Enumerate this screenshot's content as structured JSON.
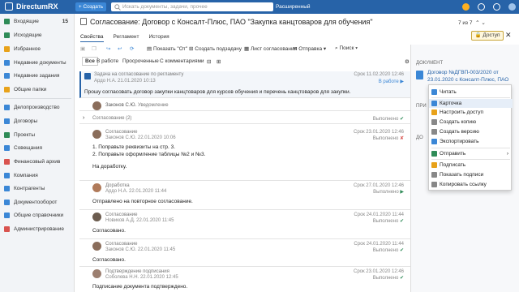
{
  "app": {
    "logo": "DirectumRX",
    "create_label": "+ Создать",
    "search_placeholder": "Искать документы, задачи, прочее",
    "advanced_search": "Расширенный поиск"
  },
  "sidebar": {
    "items": [
      {
        "label": "Входящие",
        "count": "15",
        "color": "#2e8b57"
      },
      {
        "label": "Исходящие",
        "count": "",
        "color": "#2e8b57"
      },
      {
        "label": "Избранное",
        "count": "",
        "color": "#e8a21a"
      },
      {
        "label": "Недавние документы",
        "count": "",
        "color": "#3b87d6"
      },
      {
        "label": "Недавние задания",
        "count": "",
        "color": "#3b87d6"
      },
      {
        "label": "Общие папки",
        "count": "",
        "color": "#e8a21a"
      },
      {
        "label": "Делопроизводство",
        "count": "",
        "color": "#3b87d6"
      },
      {
        "label": "Договоры",
        "count": "",
        "color": "#3b87d6"
      },
      {
        "label": "Проекты",
        "count": "",
        "color": "#2e8b57"
      },
      {
        "label": "Совещания",
        "count": "",
        "color": "#3b87d6"
      },
      {
        "label": "Финансовый архив",
        "count": "",
        "color": "#d9534f"
      },
      {
        "label": "Компания",
        "count": "",
        "color": "#3b87d6"
      },
      {
        "label": "Контрагенты",
        "count": "",
        "color": "#3b87d6"
      },
      {
        "label": "Документооборот",
        "count": "",
        "color": "#3b87d6"
      },
      {
        "label": "Общие справочники",
        "count": "",
        "color": "#3b87d6"
      },
      {
        "label": "Администрирование",
        "count": "",
        "color": "#d9534f"
      }
    ]
  },
  "header": {
    "title": "Согласование: Договор с Консалт-Плюс, ПАО \"Закупка канцтоваров для обучения\"",
    "pager": "7 из 7",
    "access": "Доступ"
  },
  "tabs": [
    "Свойства",
    "Регламент",
    "История"
  ],
  "toolbar": [
    "Показать \"От\"",
    "Создать подзадачу",
    "Лист согласования",
    "Отправка",
    "Поиск"
  ],
  "filters": [
    "Все",
    "В работе",
    "Просроченные",
    "С комментариями"
  ],
  "task": {
    "type": "Задача на согласование по регламенту",
    "author": "Ардо Н.А.   21.01.2020 10:13",
    "due": "Срок 11.02.2020 12:46",
    "status": "В работе",
    "text": "Прошу согласовать договор закупки канцтоваров для курсов обучения и перечень канцтоваров для закупки."
  },
  "notice": {
    "author": "Законов С.Ю.",
    "type": "Уведомление"
  },
  "group": {
    "label": "Согласование (2)",
    "status": "Выполнено"
  },
  "items": [
    {
      "type": "Согласование",
      "author": "Законов С.Ю.  22.01.2020 10:06",
      "due": "Срок 23.01.2020 12:46",
      "status": "Выполнено",
      "lines": [
        "1. Поправьте реквизиты на стр. 3.",
        "2. Поправьте оформление таблицы №2 и №3.",
        "",
        "На доработку."
      ],
      "avcolor": "#8a6d5b"
    },
    {
      "type": "Доработка",
      "author": "Ардо Н.А.  22.01.2020 11:44",
      "due": "Срок 27.01.2020 12:46",
      "status": "Выполнено",
      "lines": [
        "Отправлено на повторное согласование."
      ],
      "avcolor": "#b07a5a"
    },
    {
      "type": "Согласование",
      "author": "Новиков А.Д.  22.01.2020 11:45",
      "due": "Срок 24.01.2020 11:44",
      "status": "Выполнено",
      "lines": [
        "Согласовано."
      ],
      "avcolor": "#6b5c4f"
    },
    {
      "type": "Согласование",
      "author": "Законов С.Ю.  22.01.2020 11:45",
      "due": "Срок 24.01.2020 11:44",
      "status": "Выполнено",
      "lines": [
        "Согласовано."
      ],
      "avcolor": "#8a6d5b"
    },
    {
      "type": "Подтверждение подписания",
      "author": "Соболева Н.Н.  22.01.2020 12:45",
      "due": "Срок 23.01.2020 12:46",
      "status": "Выполнено",
      "lines": [
        "Подписание документа подтверждено."
      ],
      "avcolor": "#9c7f70"
    }
  ],
  "right": {
    "doc_header": "ДОКУМЕНТ",
    "doc_link": "Договор №ДГВП-003/2020 от 23.01.2020 с Консалт-Плюс, ПАО",
    "h2": "ПРИ",
    "h3": "ДО"
  },
  "menu": [
    {
      "label": "Читать",
      "color": "#3b87d6"
    },
    {
      "label": "Карточка",
      "color": "#3b87d6"
    },
    {
      "label": "Настроить доступ",
      "color": "#e8a21a"
    },
    {
      "label": "Создать копию",
      "color": "#888"
    },
    {
      "label": "Создать версию",
      "color": "#888"
    },
    {
      "label": "Экспортировать",
      "color": "#3b87d6"
    },
    {
      "label": "Отправить",
      "color": "#2e8b57"
    },
    {
      "label": "Подписать",
      "color": "#e8a21a"
    },
    {
      "label": "Показать подписи",
      "color": "#888"
    },
    {
      "label": "Копировать ссылку",
      "color": "#888"
    }
  ]
}
